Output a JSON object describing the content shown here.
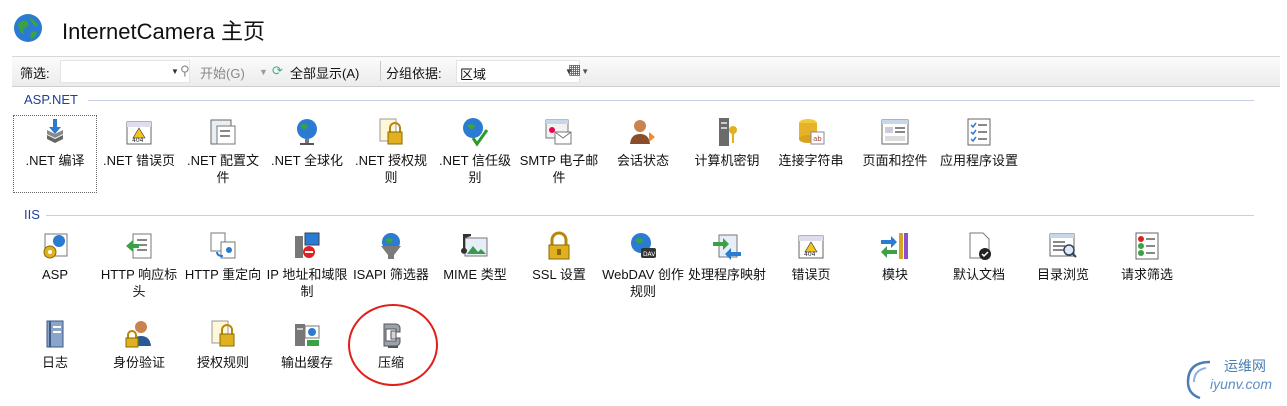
{
  "title": "InternetCamera 主页",
  "toolbar": {
    "filter_label": "筛选:",
    "start_label": "开始(G)",
    "show_all_label": "全部显示(A)",
    "group_label": "分组依据:",
    "group_value": "区域"
  },
  "sections": {
    "aspnet": "ASP.NET",
    "iis": "IIS"
  },
  "aspnet_items": [
    ".NET 编译",
    ".NET 错误页",
    ".NET 配置文件",
    ".NET 全球化",
    ".NET 授权规则",
    ".NET 信任级别",
    "SMTP 电子邮件",
    "会话状态",
    "计算机密钥",
    "连接字符串",
    "页面和控件",
    "应用程序设置"
  ],
  "iis_items_row1": [
    "ASP",
    "HTTP 响应标头",
    "HTTP 重定向",
    "IP 地址和域限制",
    "ISAPI 筛选器",
    "MIME 类型",
    "SSL 设置",
    "WebDAV 创作规则",
    "处理程序映射",
    "错误页",
    "模块",
    "默认文档",
    "目录浏览",
    "请求筛选"
  ],
  "iis_items_row2": [
    "日志",
    "身份验证",
    "授权规则",
    "输出缓存",
    "压缩"
  ],
  "watermark": {
    "cn": "运维网",
    "en": "iyunv.com"
  },
  "colors": {
    "section": "#1f3f9a",
    "highlight_circle": "#e0201a"
  }
}
